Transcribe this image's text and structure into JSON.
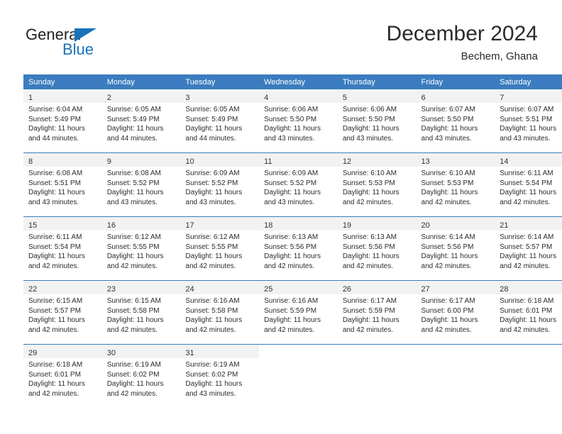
{
  "brand": {
    "word_one": "General",
    "word_two": "Blue",
    "triangle_icon": "triangle-logo-icon",
    "accent_color": "#1a72ba"
  },
  "header": {
    "title": "December 2024",
    "subtitle": "Bechem, Ghana"
  },
  "theme": {
    "header_blue": "#3a7cbf",
    "daynum_band": "#f2f2f2",
    "text": "#2b2b2b"
  },
  "weekday_headers": [
    "Sunday",
    "Monday",
    "Tuesday",
    "Wednesday",
    "Thursday",
    "Friday",
    "Saturday"
  ],
  "labels": {
    "sunrise_prefix": "Sunrise:",
    "sunset_prefix": "Sunset:",
    "daylight_prefix": "Daylight:"
  },
  "weeks": [
    {
      "days": [
        {
          "date": "1",
          "sunrise": "Sunrise: 6:04 AM",
          "sunset": "Sunset: 5:49 PM",
          "daylight": "Daylight: 11 hours and 44 minutes."
        },
        {
          "date": "2",
          "sunrise": "Sunrise: 6:05 AM",
          "sunset": "Sunset: 5:49 PM",
          "daylight": "Daylight: 11 hours and 44 minutes."
        },
        {
          "date": "3",
          "sunrise": "Sunrise: 6:05 AM",
          "sunset": "Sunset: 5:49 PM",
          "daylight": "Daylight: 11 hours and 44 minutes."
        },
        {
          "date": "4",
          "sunrise": "Sunrise: 6:06 AM",
          "sunset": "Sunset: 5:50 PM",
          "daylight": "Daylight: 11 hours and 43 minutes."
        },
        {
          "date": "5",
          "sunrise": "Sunrise: 6:06 AM",
          "sunset": "Sunset: 5:50 PM",
          "daylight": "Daylight: 11 hours and 43 minutes."
        },
        {
          "date": "6",
          "sunrise": "Sunrise: 6:07 AM",
          "sunset": "Sunset: 5:50 PM",
          "daylight": "Daylight: 11 hours and 43 minutes."
        },
        {
          "date": "7",
          "sunrise": "Sunrise: 6:07 AM",
          "sunset": "Sunset: 5:51 PM",
          "daylight": "Daylight: 11 hours and 43 minutes."
        }
      ]
    },
    {
      "days": [
        {
          "date": "8",
          "sunrise": "Sunrise: 6:08 AM",
          "sunset": "Sunset: 5:51 PM",
          "daylight": "Daylight: 11 hours and 43 minutes."
        },
        {
          "date": "9",
          "sunrise": "Sunrise: 6:08 AM",
          "sunset": "Sunset: 5:52 PM",
          "daylight": "Daylight: 11 hours and 43 minutes."
        },
        {
          "date": "10",
          "sunrise": "Sunrise: 6:09 AM",
          "sunset": "Sunset: 5:52 PM",
          "daylight": "Daylight: 11 hours and 43 minutes."
        },
        {
          "date": "11",
          "sunrise": "Sunrise: 6:09 AM",
          "sunset": "Sunset: 5:52 PM",
          "daylight": "Daylight: 11 hours and 43 minutes."
        },
        {
          "date": "12",
          "sunrise": "Sunrise: 6:10 AM",
          "sunset": "Sunset: 5:53 PM",
          "daylight": "Daylight: 11 hours and 42 minutes."
        },
        {
          "date": "13",
          "sunrise": "Sunrise: 6:10 AM",
          "sunset": "Sunset: 5:53 PM",
          "daylight": "Daylight: 11 hours and 42 minutes."
        },
        {
          "date": "14",
          "sunrise": "Sunrise: 6:11 AM",
          "sunset": "Sunset: 5:54 PM",
          "daylight": "Daylight: 11 hours and 42 minutes."
        }
      ]
    },
    {
      "days": [
        {
          "date": "15",
          "sunrise": "Sunrise: 6:11 AM",
          "sunset": "Sunset: 5:54 PM",
          "daylight": "Daylight: 11 hours and 42 minutes."
        },
        {
          "date": "16",
          "sunrise": "Sunrise: 6:12 AM",
          "sunset": "Sunset: 5:55 PM",
          "daylight": "Daylight: 11 hours and 42 minutes."
        },
        {
          "date": "17",
          "sunrise": "Sunrise: 6:12 AM",
          "sunset": "Sunset: 5:55 PM",
          "daylight": "Daylight: 11 hours and 42 minutes."
        },
        {
          "date": "18",
          "sunrise": "Sunrise: 6:13 AM",
          "sunset": "Sunset: 5:56 PM",
          "daylight": "Daylight: 11 hours and 42 minutes."
        },
        {
          "date": "19",
          "sunrise": "Sunrise: 6:13 AM",
          "sunset": "Sunset: 5:56 PM",
          "daylight": "Daylight: 11 hours and 42 minutes."
        },
        {
          "date": "20",
          "sunrise": "Sunrise: 6:14 AM",
          "sunset": "Sunset: 5:56 PM",
          "daylight": "Daylight: 11 hours and 42 minutes."
        },
        {
          "date": "21",
          "sunrise": "Sunrise: 6:14 AM",
          "sunset": "Sunset: 5:57 PM",
          "daylight": "Daylight: 11 hours and 42 minutes."
        }
      ]
    },
    {
      "days": [
        {
          "date": "22",
          "sunrise": "Sunrise: 6:15 AM",
          "sunset": "Sunset: 5:57 PM",
          "daylight": "Daylight: 11 hours and 42 minutes."
        },
        {
          "date": "23",
          "sunrise": "Sunrise: 6:15 AM",
          "sunset": "Sunset: 5:58 PM",
          "daylight": "Daylight: 11 hours and 42 minutes."
        },
        {
          "date": "24",
          "sunrise": "Sunrise: 6:16 AM",
          "sunset": "Sunset: 5:58 PM",
          "daylight": "Daylight: 11 hours and 42 minutes."
        },
        {
          "date": "25",
          "sunrise": "Sunrise: 6:16 AM",
          "sunset": "Sunset: 5:59 PM",
          "daylight": "Daylight: 11 hours and 42 minutes."
        },
        {
          "date": "26",
          "sunrise": "Sunrise: 6:17 AM",
          "sunset": "Sunset: 5:59 PM",
          "daylight": "Daylight: 11 hours and 42 minutes."
        },
        {
          "date": "27",
          "sunrise": "Sunrise: 6:17 AM",
          "sunset": "Sunset: 6:00 PM",
          "daylight": "Daylight: 11 hours and 42 minutes."
        },
        {
          "date": "28",
          "sunrise": "Sunrise: 6:18 AM",
          "sunset": "Sunset: 6:01 PM",
          "daylight": "Daylight: 11 hours and 42 minutes."
        }
      ]
    },
    {
      "days": [
        {
          "date": "29",
          "sunrise": "Sunrise: 6:18 AM",
          "sunset": "Sunset: 6:01 PM",
          "daylight": "Daylight: 11 hours and 42 minutes."
        },
        {
          "date": "30",
          "sunrise": "Sunrise: 6:19 AM",
          "sunset": "Sunset: 6:02 PM",
          "daylight": "Daylight: 11 hours and 42 minutes."
        },
        {
          "date": "31",
          "sunrise": "Sunrise: 6:19 AM",
          "sunset": "Sunset: 6:02 PM",
          "daylight": "Daylight: 11 hours and 43 minutes."
        },
        {
          "date": "",
          "sunrise": "",
          "sunset": "",
          "daylight": ""
        },
        {
          "date": "",
          "sunrise": "",
          "sunset": "",
          "daylight": ""
        },
        {
          "date": "",
          "sunrise": "",
          "sunset": "",
          "daylight": ""
        },
        {
          "date": "",
          "sunrise": "",
          "sunset": "",
          "daylight": ""
        }
      ]
    }
  ]
}
